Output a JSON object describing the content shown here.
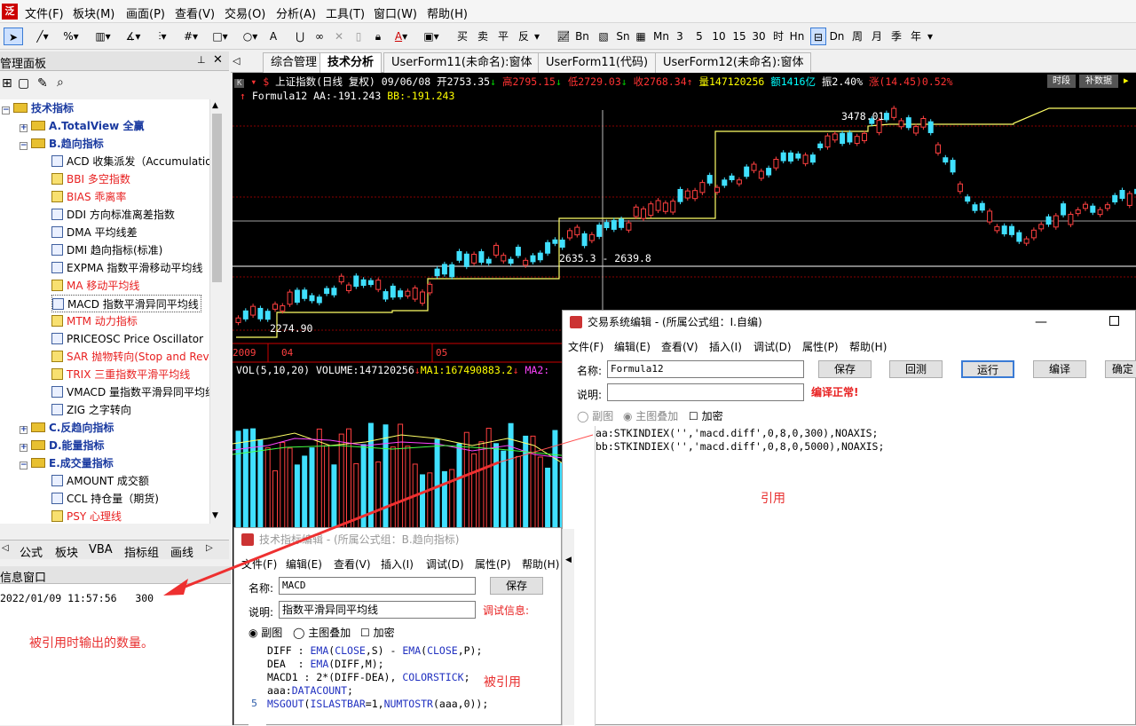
{
  "app": {
    "logo": "泛"
  },
  "menu": [
    "文件(F)",
    "板块(M)",
    "画面(P)",
    "查看(V)",
    "交易(O)",
    "分析(A)",
    "工具(T)",
    "窗口(W)",
    "帮助(H)"
  ],
  "toolbar": {
    "buttons": [
      "买",
      "卖",
      "平",
      "反",
      "Bn",
      "Sn",
      "Mn",
      "3",
      "5",
      "10",
      "15",
      "30",
      "时",
      "Hn",
      "Dn",
      "周",
      "月",
      "季",
      "年"
    ]
  },
  "panel": {
    "title": "管理面板",
    "pin": "ᵖ",
    "close": "✕",
    "tree": {
      "root": "技术指标",
      "groups": [
        {
          "label": "A.TotalView 全赢"
        },
        {
          "label": "B.趋向指标"
        }
      ],
      "items": [
        {
          "label": "ACD 收集派发（Accumulatio"
        },
        {
          "label": "BBI 多空指数"
        },
        {
          "label": "BIAS 乖离率"
        },
        {
          "label": "DDI 方向标准离差指数"
        },
        {
          "label": "DMA 平均线差"
        },
        {
          "label": "DMI 趋向指标(标准)"
        },
        {
          "label": "EXPMA 指数平滑移动平均线"
        },
        {
          "label": "MA 移动平均线"
        },
        {
          "label": "MACD 指数平滑异同平均线"
        },
        {
          "label": "MTM 动力指标"
        },
        {
          "label": "PRICEOSC Price Oscillator"
        },
        {
          "label": "SAR 抛物转向(Stop and Reve"
        },
        {
          "label": "TRIX 三重指数平滑平均线"
        },
        {
          "label": "VMACD 量指数平滑异同平均线"
        },
        {
          "label": "ZIG 之字转向"
        }
      ],
      "groups2": [
        {
          "label": "C.反趋向指标"
        },
        {
          "label": "D.能量指标"
        },
        {
          "label": "E.成交量指标"
        }
      ],
      "items2": [
        {
          "label": "AMOUNT 成交额"
        },
        {
          "label": "CCL 持仓量（期货)"
        },
        {
          "label": "PSY 心理线"
        }
      ]
    },
    "tabs": [
      "公式",
      "板块",
      "VBA",
      "指标组",
      "画线"
    ]
  },
  "info": {
    "title": "信息窗口",
    "line": "2022/01/09 11:57:56   300"
  },
  "doc_tabs": [
    "综合管理",
    "技术分析",
    "UserForm11(未命名):窗体",
    "UserForm11(代码)",
    "UserForm12(未命名):窗体"
  ],
  "chart": {
    "header": {
      "name": "上证指数(日线 复权)",
      "date": "09/06/08",
      "open": "开2753.35",
      "high": "高2795.15",
      "low": "低2729.03",
      "close": "收2768.34",
      "vol": "量147120256",
      "amt": "额1416亿",
      "swing": "振2.40%",
      "chg": "涨(14.45)0.52%",
      "btn1": "时段",
      "btn2": "补数据"
    },
    "formula_line": {
      "name": "Formula12",
      "aa": "AA:-191.243",
      "bb": "BB:-191.243"
    },
    "labels": {
      "hi": "3478.01",
      "mid": "2635.3 - 2639.8",
      "lo": "2274.90"
    },
    "x_labels": [
      "2009",
      "04",
      "05"
    ],
    "vol_line": {
      "title": "VOL(5,10,20) VOLUME:147120256",
      "ma1": "MA1:167490883.2",
      "ma2": "MA2:"
    }
  },
  "trade_dlg": {
    "title": "交易系统编辑 - (所属公式组：I.自编)",
    "menu": [
      "文件(F)",
      "编辑(E)",
      "查看(V)",
      "插入(I)",
      "调试(D)",
      "属性(P)",
      "帮助(H)"
    ],
    "name_label": "名称:",
    "name_value": "Formula12",
    "desc_label": "说明:",
    "status": "编译正常!",
    "buttons": [
      "保存",
      "回测",
      "运行",
      "编译",
      "确定"
    ],
    "opts": [
      "副图",
      "主图叠加",
      "加密"
    ],
    "code": [
      "aa:STKINDIEX('','macd.diff',0,8,0,300),NOAXIS;",
      "bb:STKINDIEX('','macd.diff',0,8,0,5000),NOAXIS;"
    ]
  },
  "tech_dlg": {
    "title": "技术指标编辑 - (所属公式组：B.趋向指标)",
    "menu": [
      "文件(F)",
      "编辑(E)",
      "查看(V)",
      "插入(I)",
      "调试(D)",
      "属性(P)",
      "帮助(H)"
    ],
    "name_label": "名称:",
    "name_value": "MACD",
    "desc_label": "说明:",
    "desc_value": "指数平滑异同平均线",
    "debug": "调试信息:",
    "save": "保存",
    "opts": [
      "副图",
      "主图叠加",
      "加密"
    ],
    "gutter": "5",
    "code": [
      "DIFF : EMA(CLOSE,S) - EMA(CLOSE,P);",
      "DEA  : EMA(DIFF,M);",
      "MACD1 : 2*(DIFF-DEA), COLORSTICK;",
      "aaa:DATACOUNT;",
      "MSGOUT(ISLASTBAR=1,NUMTOSTR(aaa,0));"
    ]
  },
  "annotations": {
    "ref": "引用",
    "referenced": "被引用",
    "output": "被引用时输出的数量。"
  }
}
